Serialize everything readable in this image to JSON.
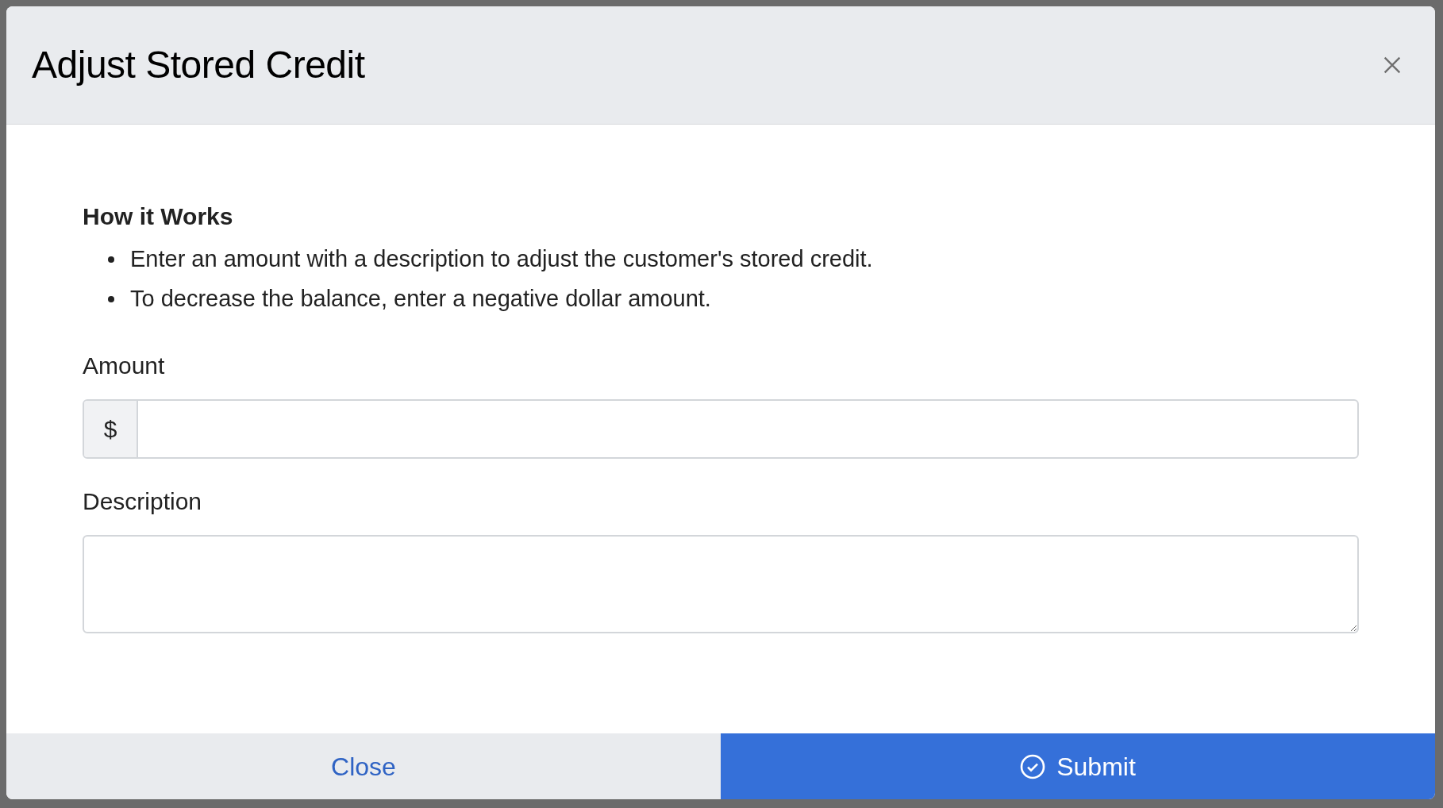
{
  "dialog": {
    "title": "Adjust Stored Credit"
  },
  "how_it_works": {
    "heading": "How it Works",
    "bullets": [
      "Enter an amount with a description to adjust the customer's stored credit.",
      "To decrease the balance, enter a negative dollar amount."
    ]
  },
  "amount": {
    "label": "Amount",
    "prefix": "$"
  },
  "description": {
    "label": "Description"
  },
  "buttons": [
    {
      "kind": "secondary",
      "label": "Close"
    },
    {
      "kind": "primary",
      "label": "Submit"
    }
  ]
}
